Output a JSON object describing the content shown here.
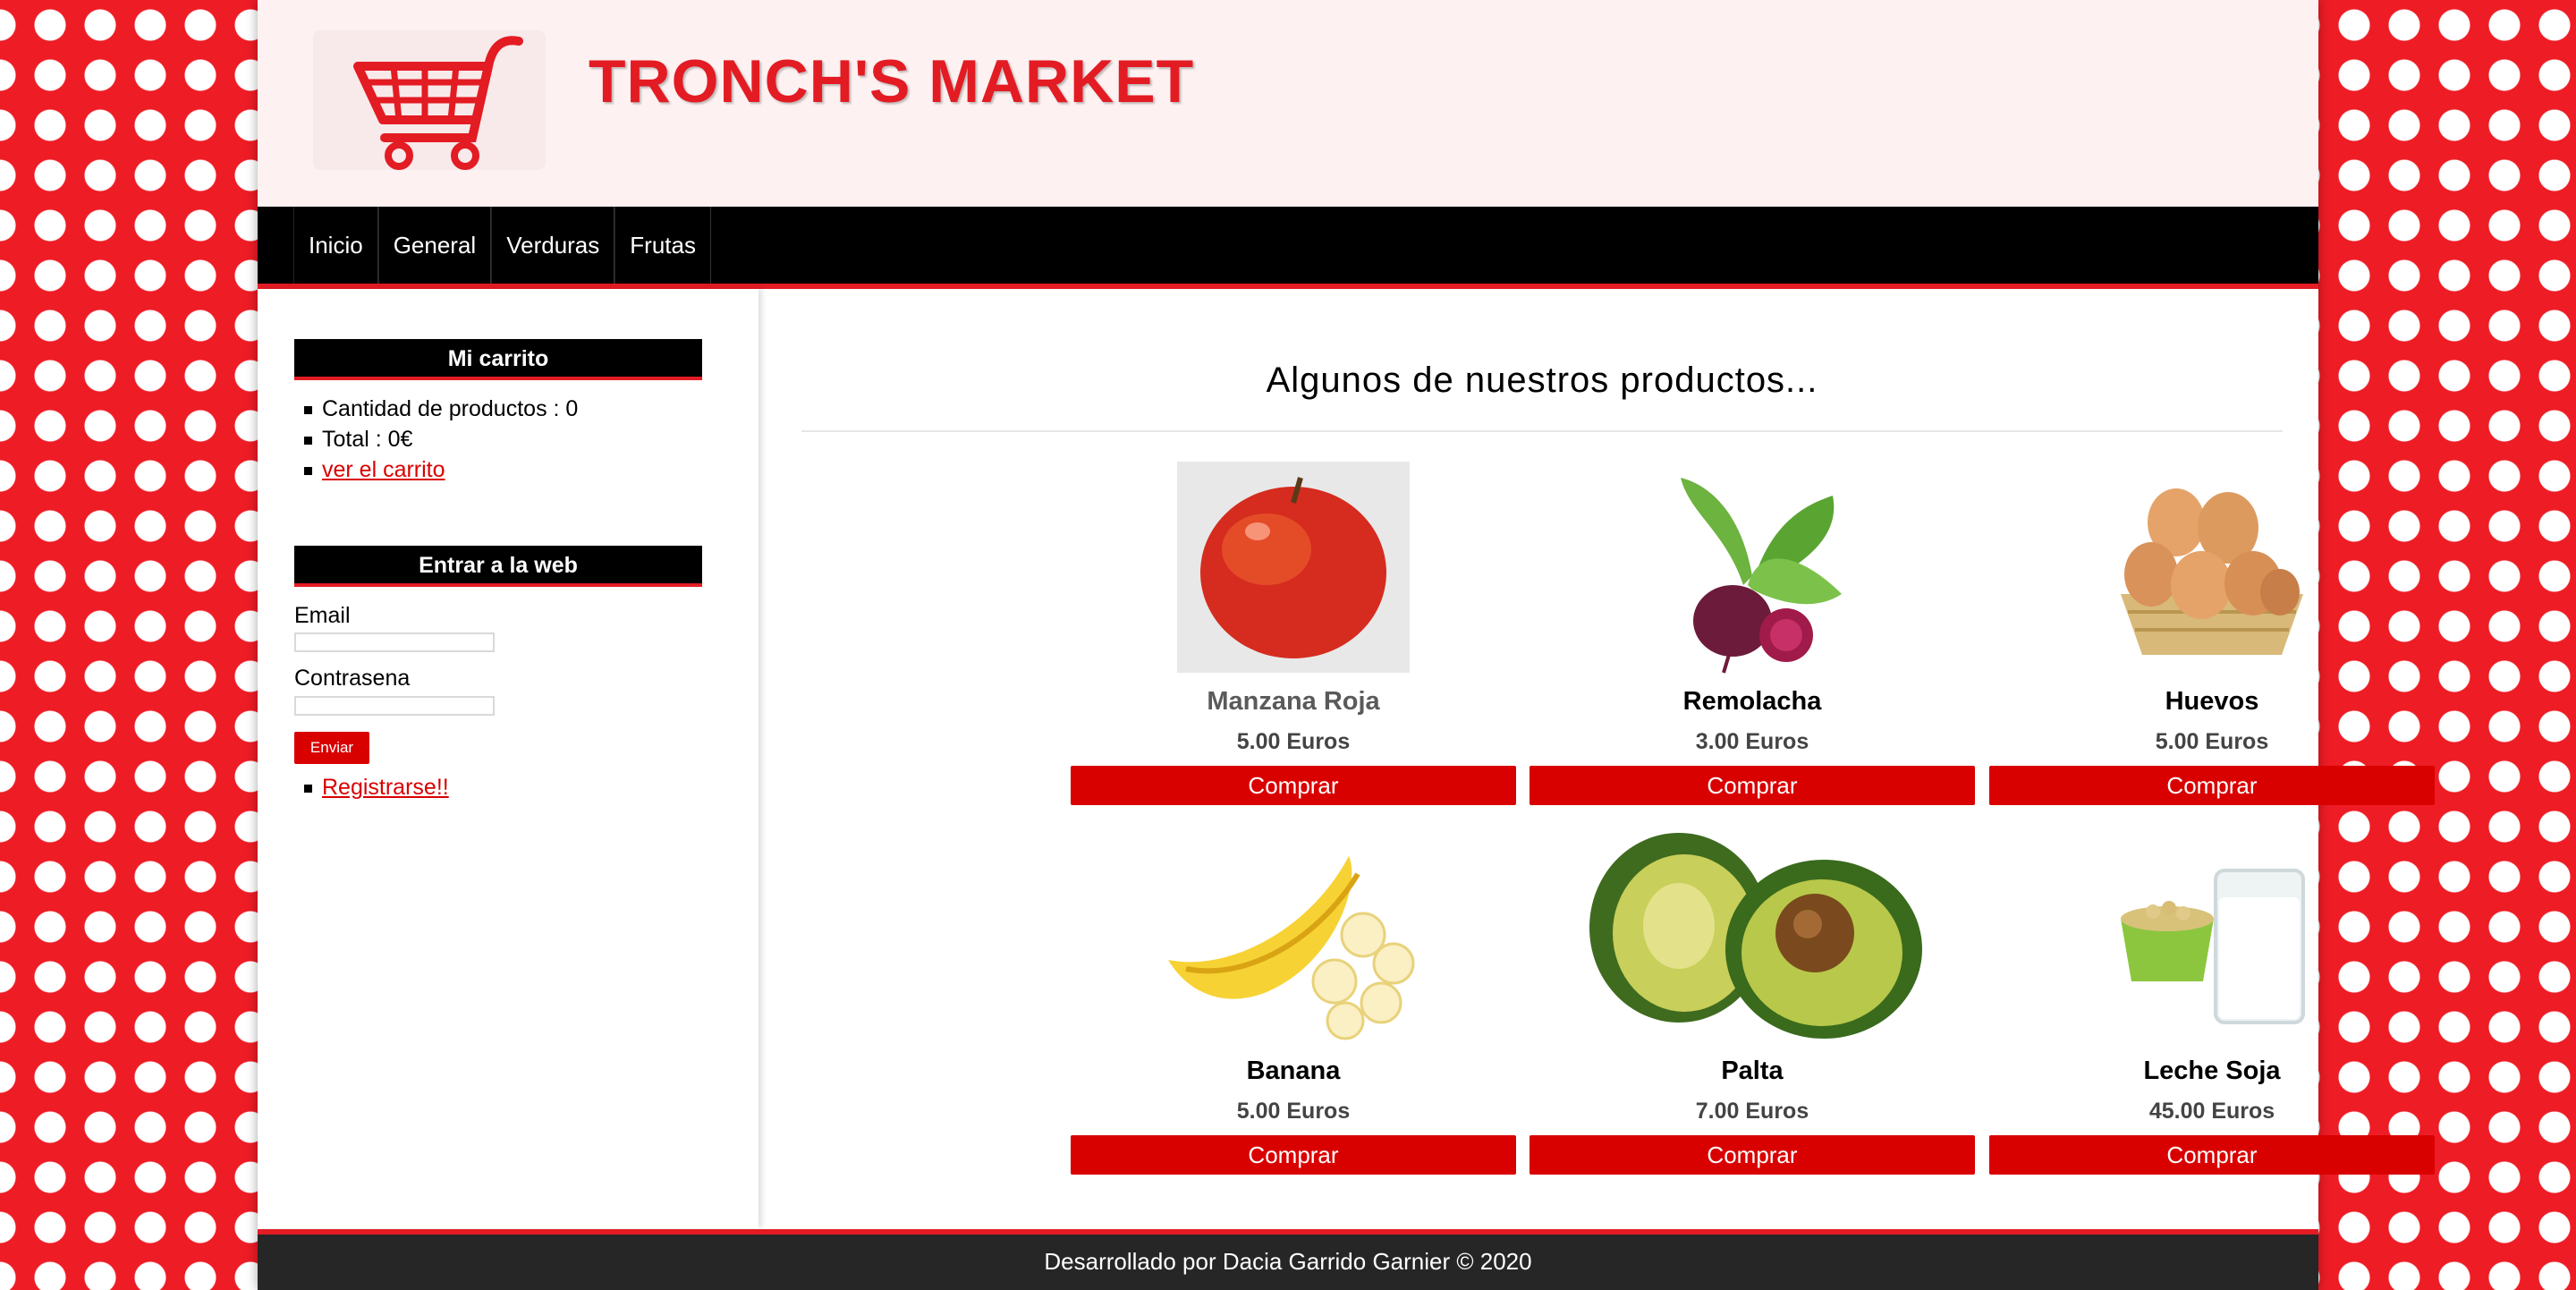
{
  "header": {
    "brand": "TRONCH'S MARKET",
    "logo_icon": "shopping-cart-icon"
  },
  "nav": {
    "items": [
      "Inicio",
      "General",
      "Verduras",
      "Frutas"
    ]
  },
  "cart": {
    "title": "Mi carrito",
    "quantity_text": "Cantidad de productos : 0",
    "total_text": "Total : 0€",
    "view_link": "ver el carrito"
  },
  "login": {
    "title": "Entrar a la web",
    "email_label": "Email",
    "email_value": "",
    "password_label": "Contrasena",
    "password_value": "",
    "send_label": "Enviar",
    "register_link": "Registrarse!!"
  },
  "main": {
    "title": "Algunos de nuestros productos...",
    "products": [
      {
        "name": "Manzana Roja",
        "price": "5.00 Euros",
        "button": "Comprar",
        "icon": "apple-icon"
      },
      {
        "name": "Remolacha",
        "price": "3.00 Euros",
        "button": "Comprar",
        "icon": "beetroot-icon"
      },
      {
        "name": "Huevos",
        "price": "5.00 Euros",
        "button": "Comprar",
        "icon": "eggs-icon"
      },
      {
        "name": "Banana",
        "price": "5.00 Euros",
        "button": "Comprar",
        "icon": "banana-icon"
      },
      {
        "name": "Palta",
        "price": "7.00 Euros",
        "button": "Comprar",
        "icon": "avocado-icon"
      },
      {
        "name": "Leche Soja",
        "price": "45.00 Euros",
        "button": "Comprar",
        "icon": "soy-milk-icon"
      }
    ]
  },
  "footer": {
    "text": "Desarrollado por Dacia Garrido Garnier © 2020"
  },
  "colors": {
    "accent": "#e31b23",
    "button": "#d90000",
    "nav": "#000000",
    "footer": "#262626",
    "header_bg": "#fdf1f1"
  }
}
